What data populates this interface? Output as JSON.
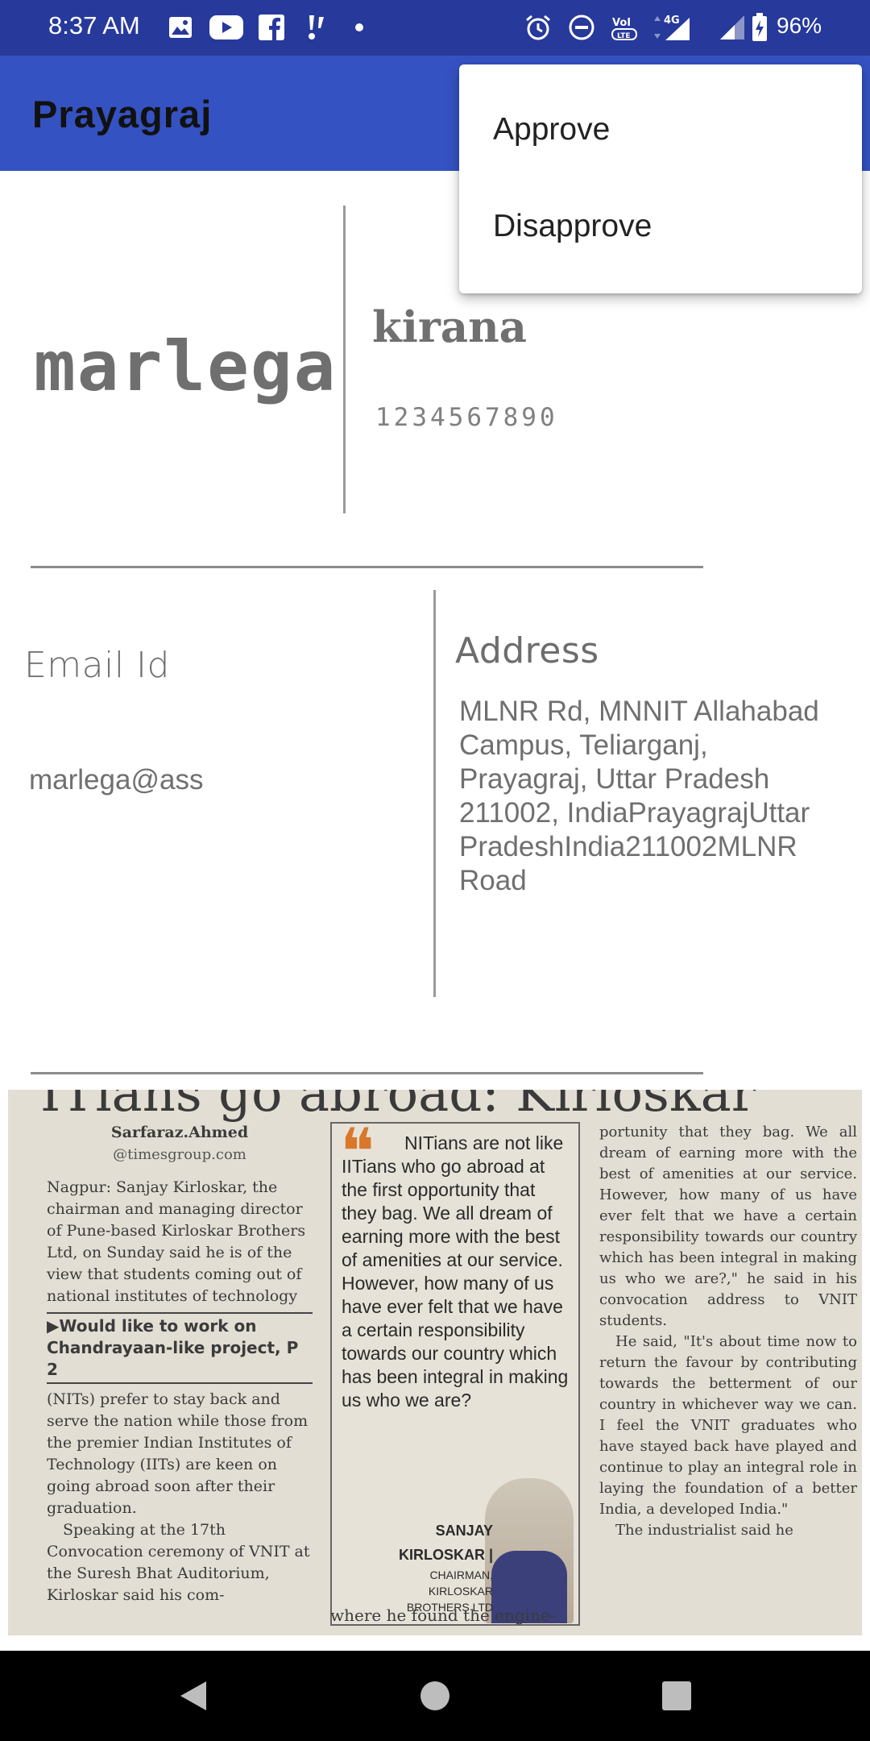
{
  "status_bar": {
    "time": "8:37 AM",
    "battery_percent": "96%",
    "network_label": "4G",
    "icons": [
      "photos-icon",
      "youtube-icon",
      "facebook-icon",
      "notification-icon",
      "dot-icon",
      "alarm-icon",
      "do-not-disturb-icon",
      "volte-icon",
      "signal-icon",
      "signal-weak-icon",
      "battery-charging-icon"
    ]
  },
  "app_bar": {
    "title": "Prayagraj"
  },
  "popup_menu": {
    "items": [
      "Approve",
      "Disapprove"
    ]
  },
  "profile": {
    "owner_name": "marlega",
    "shop_name": "kirana",
    "phone": "1234567890"
  },
  "contact": {
    "email_label": "Email Id",
    "email_value": "marlega@ass",
    "address_label": "Address",
    "address_value": "MLNR Rd, MNNIT Allahabad Campus, Teliarganj, Prayagraj, Uttar Pradesh 211002, IndiaPrayagrajUttar PradeshIndia211002MLNR Road"
  },
  "clipping": {
    "headline": "ITians go abroad: Kirloskar",
    "byline": "Sarfaraz.Ahmed",
    "byline_email": "@timesgroup.com",
    "left_text_1": "Nagpur: Sanjay Kirloskar, the chairman and managing director of Pune-based Kirloskar Brothers Ltd, on Sunday said he is of the view that students coming out of national institutes of technology",
    "teaser": "▶Would like to work on Chandrayaan-like project, P 2",
    "left_text_2": "(NITs) prefer to stay back and serve the nation while those from the premier Indian Institutes of Technology (IITs) are keen on going abroad soon after their graduation.",
    "left_text_3": "Speaking at the 17th Convocation ceremony of VNIT at the Suresh Bhat Auditorium, Kirloskar said his com-",
    "quote": "NITians are not like IITians who go abroad at the first opportunity that they bag. We all dream of earning more with the best of amenities at our service. However, how many of us have ever felt that we have a certain responsibility towards our country which has been integral in making us who we are?",
    "attribution_name": "SANJAY KIRLOSKAR |",
    "attribution_role": "CHAIRMAN, KIRLOSKAR BROTHERS LTD",
    "right_text_1": "portunity that they bag. We all dream of earning more with the best of amenities at our service. However, how many of us have ever felt that we have a certain responsibility towards our country which has been integral in making us who we are?,\" he said in his convocation address to VNIT students.",
    "right_text_2": "He said, \"It's about time now to return the favour by contributing towards the betterment of our country in whichever way we can. I feel the VNIT graduates who have stayed back have played and continue to play an integral role in laying the foundation of a better India, a developed India.\"",
    "right_text_3": "The industrialist said he",
    "bottom_text": "where he found the engine-"
  },
  "nav_bar": {
    "buttons": [
      "back-icon",
      "home-icon",
      "recents-icon"
    ]
  }
}
